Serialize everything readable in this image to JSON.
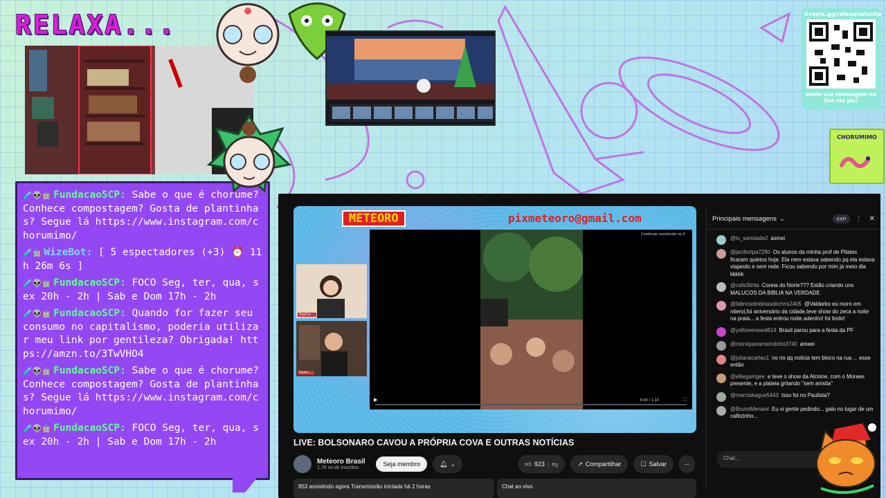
{
  "overlay": {
    "logo": "RELAXA...",
    "chat": [
      {
        "badges": "🧪👽🤖",
        "user": "FundacaoSCP:",
        "text": "Sabe o que é chorume? Conhece compostagem? Gosta de plantinhas? Segue lá https://www.instagram.com/chorumimo/",
        "style": "green"
      },
      {
        "badges": "🧪🤖",
        "user": "WizeBot:",
        "text": "[ 5 espectadores (+3) ⏰ 11h 26m 6s ]",
        "style": "blue"
      },
      {
        "badges": "🧪👽🤖",
        "user": "FundacaoSCP:",
        "text": "FOCO Seg, ter, qua, sex 20h - 2h | Sab e Dom 17h - 2h",
        "style": "green"
      },
      {
        "badges": "🧪👽🤖",
        "user": "FundacaoSCP:",
        "text": "Quando for fazer seu consumo no capitalismo, poderia utilizar meu link por gentileza? Obrigada! https://amzn.to/3TwVHO4",
        "style": "green"
      },
      {
        "badges": "🧪👽🤖",
        "user": "FundacaoSCP:",
        "text": "Sabe o que é chorume? Conhece compostagem? Gosta de plantinhas? Segue lá https://www.instagram.com/chorumimo/",
        "style": "green"
      },
      {
        "badges": "🧪👽🤖",
        "user": "FundacaoSCP:",
        "text": "FOCO Seg, ter, qua, sex 20h - 2h | Sab e Dom 17h - 2h",
        "style": "green"
      }
    ],
    "qr": {
      "url": "livepix.gg/relaxanatasha",
      "caption": "envie sua mensagem na live via pix!"
    },
    "chorumimo_label": "CHORUMIMO"
  },
  "youtube": {
    "player": {
      "brand": "METEORO",
      "pix": "pixmeteoro@gmail.com",
      "guest1": "Sophia ...",
      "guest2": "Pedro ...",
      "continue": "Continuar assistindo no X",
      "time": "0:00 / 1:10"
    },
    "title": "LIVE: BOLSONARO CAVOU A PRÓPRIA COVA E OUTRAS NOTÍCIAS",
    "channel": {
      "name": "Meteoro Brasil",
      "subs": "1,78 mi de inscritos",
      "join": "Seja membro"
    },
    "actions": {
      "likes": "923",
      "share": "Compartilhar",
      "save": "Salvar"
    },
    "stats": "853 assistindo agora  Transmissão iniciada há 2 horas",
    "chat_replay": "Chat ao vivo",
    "chat": {
      "header": "Principais mensagens",
      "xp": "0XP",
      "input_placeholder": "Chat...",
      "messages": [
        {
          "name": "@ts_sanidade2",
          "text": "asmei",
          "color": "#9cc"
        },
        {
          "name": "@jacilloripa7280",
          "text": "Os alunos da minha prof de Pilates ficaram quietos hoje. Ela nem estava sabendo pq ela estava viajando e sem rede. Ficou sabendo por mim já meio dia kkkkk",
          "color": "#c99"
        },
        {
          "name": "@cafe3tinta",
          "text": "Coreia do Norte??? Estão criando uns MALUCOS DA BIBLIA NA VERDADE",
          "color": "#bbb"
        },
        {
          "name": "@fabricadeideiasdechris2405",
          "text": "@Valdarko eu moro em niteroi,foi aniversário da cidade,teve show do zeca a noite na praia... a festa entrou noite adentro! foi lindo!",
          "color": "#d9a"
        },
        {
          "name": "@yellowerased614",
          "text": "Brasil parou para a festa da PF",
          "color": "#c4c"
        },
        {
          "name": "@moniquerameirobrito3740",
          "text": "ameei",
          "color": "#999"
        },
        {
          "name": "@julianacarlao1",
          "text": "no rio qq noticia tem bloco na rua ... esse então",
          "color": "#d88"
        },
        {
          "name": "@elliegamgee",
          "text": "e teve o show da Alcione, com o Moraes presente, e a plateia gritando \"sem anistia\"",
          "color": "#c97"
        },
        {
          "name": "@marciokague5443",
          "text": "Isso foi no Paulista?",
          "color": "#9a9"
        },
        {
          "name": "@BrunoMenaini",
          "text": "Eu vi gente pedindo... galo no lugar de um cafézinho...",
          "color": "#aaa"
        }
      ]
    }
  }
}
